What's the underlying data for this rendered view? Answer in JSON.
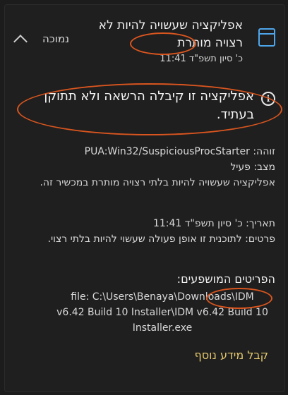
{
  "notification": {
    "title": "אפליקציה שעשויה להיות לא רצויה מותרת",
    "date": "כ' סיון תשפ\"ד 11:41",
    "status": "נמוכה"
  },
  "warning": {
    "message": "אפליקציה זו קיבלה הרשאה ולא תתוקן בעתיד."
  },
  "details": {
    "detected_label": "זוהה:",
    "detected_value": "PUA:Win32/SuspiciousProcStarter",
    "state_label": "מצב:",
    "state_value": "פעיל",
    "description": "אפליקציה שעשויה להיות בלתי רצויה מותרת במכשיר זה.",
    "date_label": "תאריך:",
    "date_value": "כ' סיון תשפ\"ד 11:41",
    "details_label": "פרטים:",
    "details_value": "לתוכנית זו אופן פעולה שעשוי להיות בלתי רצוי."
  },
  "affected": {
    "title": "הפריטים המושפעים:",
    "path": "file: C:\\Users\\Benaya\\Downloads\\IDM v6.42 Build 10 Installer\\IDM v6.42 Build 10 Installer.exe"
  },
  "link": {
    "more_info": "קבל מידע נוסף"
  },
  "icons": {
    "header": "shield-window-icon",
    "info": "info-circle-icon",
    "collapse": "chevron-up-icon"
  },
  "colors": {
    "accent": "#4ea6ea",
    "link": "#e4c86e",
    "annotation": "#d9551f",
    "background": "#1f1f1f"
  }
}
